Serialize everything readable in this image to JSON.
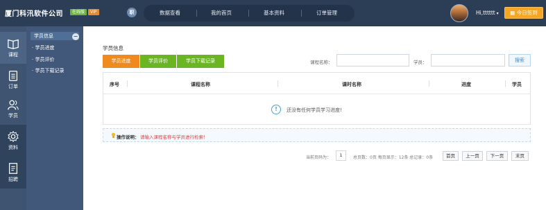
{
  "header": {
    "brand": "厦门科汛软件公司",
    "badge_online": "在线版",
    "badge_vip": "VIP",
    "logo_char": "职",
    "nav": [
      "数据查看",
      "我的首页",
      "基本资料",
      "订单管理"
    ],
    "user": "Hi,tttttt",
    "signin_label": "今日签到",
    "colors": {
      "topbar": "#2c3e56",
      "signin": "#f5a623"
    }
  },
  "rail": [
    {
      "label": "课程",
      "icon": "book-icon"
    },
    {
      "label": "订单",
      "icon": "clipboard-icon"
    },
    {
      "label": "学员",
      "icon": "users-icon"
    },
    {
      "label": "资料",
      "icon": "gear-icon"
    },
    {
      "label": "招聘",
      "icon": "document-icon"
    }
  ],
  "submenu": {
    "items": [
      "学员信息",
      "学员进度",
      "学员评价",
      "学员下载记录"
    ],
    "collapse_symbol": "−"
  },
  "main": {
    "title": "学员信息",
    "tabs": [
      "学员进度",
      "学员评价",
      "学员下载记录"
    ],
    "course_label": "课程名称：",
    "student_label": "学员：",
    "search_label": "搜索",
    "course_value": "",
    "student_value": "",
    "table": {
      "headers": [
        "序号",
        "课程名称",
        "课时名称",
        "进度",
        "学员"
      ],
      "empty_icon": "!",
      "empty_text": "还没有任何学员学习进度!"
    },
    "tip": {
      "title": "操作说明：",
      "text": "请输入课程名称与学员进行检索！"
    },
    "pagination": {
      "current_label": "当前页码为：",
      "current_page": "1",
      "summary": "总页数：0页 每页显示：12条 总记录：0条",
      "buttons": [
        "首页",
        "上一页",
        "下一页",
        "末页"
      ]
    }
  }
}
